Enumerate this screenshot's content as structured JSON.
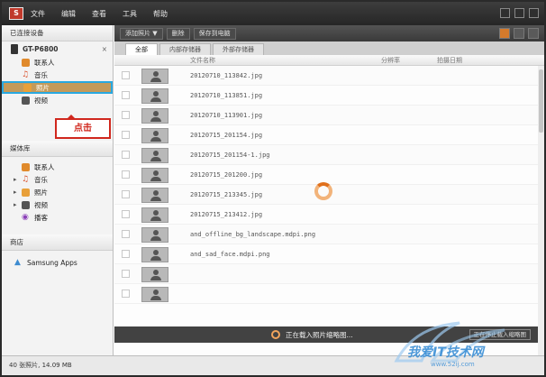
{
  "menubar": {
    "logo": "S",
    "items": [
      "文件",
      "编辑",
      "查看",
      "工具",
      "帮助"
    ]
  },
  "sidebar": {
    "connected_header": "已连接设备",
    "device_name": "GT-P6800",
    "device_close": "×",
    "device_items": [
      {
        "label": "联系人",
        "icon": "contacts-icon"
      },
      {
        "label": "音乐",
        "icon": "music-icon"
      },
      {
        "label": "照片",
        "icon": "photos-icon"
      },
      {
        "label": "视频",
        "icon": "video-icon"
      }
    ],
    "callout": "点击",
    "library_header": "媒体库",
    "library_items": [
      {
        "label": "联系人",
        "icon": "contacts-icon"
      },
      {
        "label": "音乐",
        "icon": "music-icon"
      },
      {
        "label": "照片",
        "icon": "photos-icon"
      },
      {
        "label": "视频",
        "icon": "video-icon"
      },
      {
        "label": "播客",
        "icon": "podcast-icon"
      }
    ],
    "store_header": "商店",
    "store_item": "Samsung Apps"
  },
  "toolbar": {
    "add_photo": "添加照片 ▼",
    "delete": "删除",
    "save_to_pc": "保存到电脑"
  },
  "tabs": [
    "全部",
    "内部存储器",
    "外部存储器"
  ],
  "columns": {
    "filename": "文件名称",
    "resolution": "分辨率",
    "date": "拍摄日期"
  },
  "files": [
    "20120710_113842.jpg",
    "20120710_113851.jpg",
    "20120710_113901.jpg",
    "20120715_201154.jpg",
    "20120715_201154-1.jpg",
    "20120715_201200.jpg",
    "20120715_213345.jpg",
    "20120715_213412.jpg",
    "and_offline_bg_landscape.mdpi.png",
    "and_sad_face.mdpi.png",
    "",
    ""
  ],
  "loading": {
    "text": "正在载入照片缩略图...",
    "stop_button": "正在停止载入缩略图"
  },
  "status": "40 张照片, 14.09 MB",
  "watermark": {
    "text": "我爱IT技术网",
    "url": "www.52ij.com"
  }
}
